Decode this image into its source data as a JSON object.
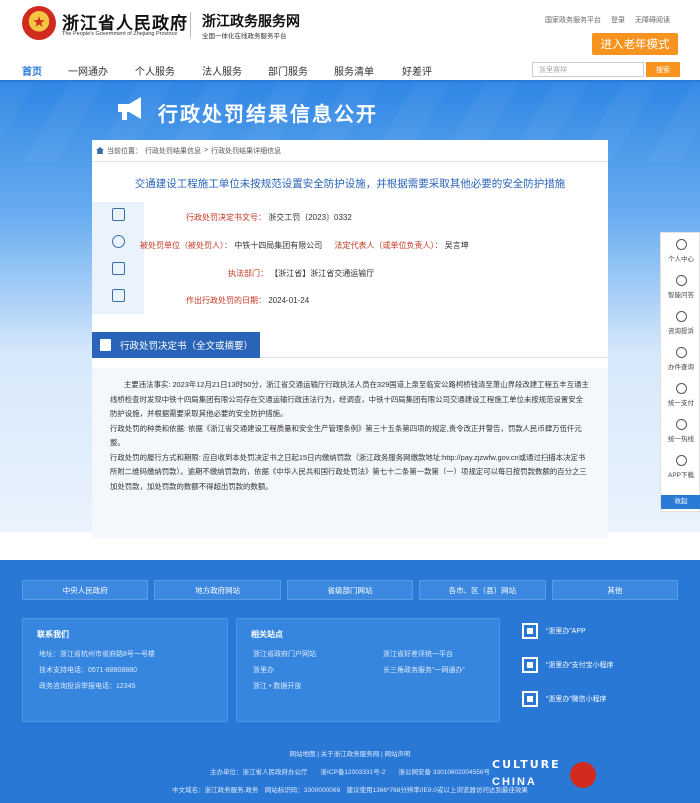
{
  "header": {
    "gov_title": "浙江省人民政府",
    "gov_subtitle": "The People's Government of Zhejiang Province",
    "site_title": "浙江政务服务网",
    "site_subtitle": "全国一体化在线政务服务平台",
    "top_links": [
      "国家政务服务平台",
      "登录",
      "无障碍阅读"
    ],
    "elder_mode": "进入老年模式"
  },
  "nav": {
    "items": [
      "首页",
      "一网通办",
      "个人服务",
      "法人服务",
      "部门服务",
      "服务清单",
      "好差评"
    ],
    "search_placeholder": "浙里赛样",
    "search_button": "搜索"
  },
  "banner": {
    "title": "行政处罚结果信息公开"
  },
  "breadcrumb": {
    "items": [
      "当前位置：",
      "行政处罚结果信息",
      ">",
      "行政处罚结果详细信息"
    ]
  },
  "document": {
    "title": "交通建设工程施工单位未按规范设置安全防护设施，并根据需要采取其他必要的安全防护措施",
    "decision_no_label": "行政处罚决定书文号：",
    "decision_no": "浙交工罚〔2023〕0332",
    "party_label": "被处罚单位（被处罚人）：",
    "party": "中铁十四局集团有限公司",
    "legal_rep_label": "法定代表人（或单位负责人）：",
    "legal_rep": "吴言坤",
    "dept_label": "执法部门：",
    "dept": "【浙江省】浙江省交通运输厅",
    "date_label": "作出行政处罚的日期：",
    "date": "2024-01-24",
    "section_title": "行政处罚决定书（全文或摘要）",
    "p1": "主要违法事实: 2023年12月21日13时50分，浙江省交通运输厅行政执法人员在329国道上泉至临安公路柯桥钱清至萧山界段改建工程五丰互通主线桥检查时发现中铁十四局集团有限公司存在交通运输行政违法行为，经调查，中铁十四局集团有限公司交通建设工程施工单位未按规范设置安全防护设施，并根据需要采取其他必要的安全防护措施。",
    "p2": "行政处罚的种类和依据: 依据《浙江省交通建设工程质量和安全生产管理条例》第三十五条第四项的规定,责令改正并警告，罚款人民币肆万伍仟元整。",
    "p3": "行政处罚的履行方式和期限: 应自收到本处罚决定书之日起15日内缴纳罚款（浙江政务服务网缴款地址:http://pay.zjzwfw.gov.cn或通过扫描本决定书所附二维码缴纳罚款）。逾期不缴纳罚款的，依据《中华人民共和国行政处罚法》第七十二条第一款第（一）项规定可以每日按罚款数额的百分之三加处罚款，加处罚款的数额不得超出罚款的数额。"
  },
  "sidebar": {
    "items": [
      "个人中心",
      "智能问答",
      "咨询投诉",
      "办件查询",
      "统一支付",
      "统一热线",
      "APP下载",
      "收起"
    ]
  },
  "footer": {
    "links": [
      "中央人民政府",
      "地方政府网站",
      "省级部门网站",
      "各市、区（县）网站",
      "其他"
    ],
    "contact_title": "联系我们",
    "contact_lines": [
      "地址：浙江省杭州市省府路8号一号楼",
      "技术支持电话：0571-88808880",
      "政务咨询投诉举报电话：12345"
    ],
    "related_title": "相关站点",
    "related_col1": [
      "浙江省政府门户网站",
      "浙里办",
      "浙江 • 数据开放"
    ],
    "related_col2": [
      "浙江省好差评统一平台",
      "长三角政务服务“一网通办”"
    ],
    "apps": [
      "“浙里办”APP",
      "“浙里办”支付宝小程序",
      "“浙里办”微信小程序"
    ],
    "bottom1": "网站地图 | 关于浙江政务服务网 | 网站声明",
    "bottom2": "主办单位：浙江省人民政府办公厅　　浙ICP备12003331号-2　　浙公网安备 33010602004556号",
    "bottom3": "中文域名：浙江政务服务.政务　网站标识码：3300000069　建议使用1366*768分辨率/IE9.0或以上浏览器访问达到最佳效果"
  },
  "watermark": {
    "line1": "CULTURE",
    "line2": "CHINA"
  }
}
